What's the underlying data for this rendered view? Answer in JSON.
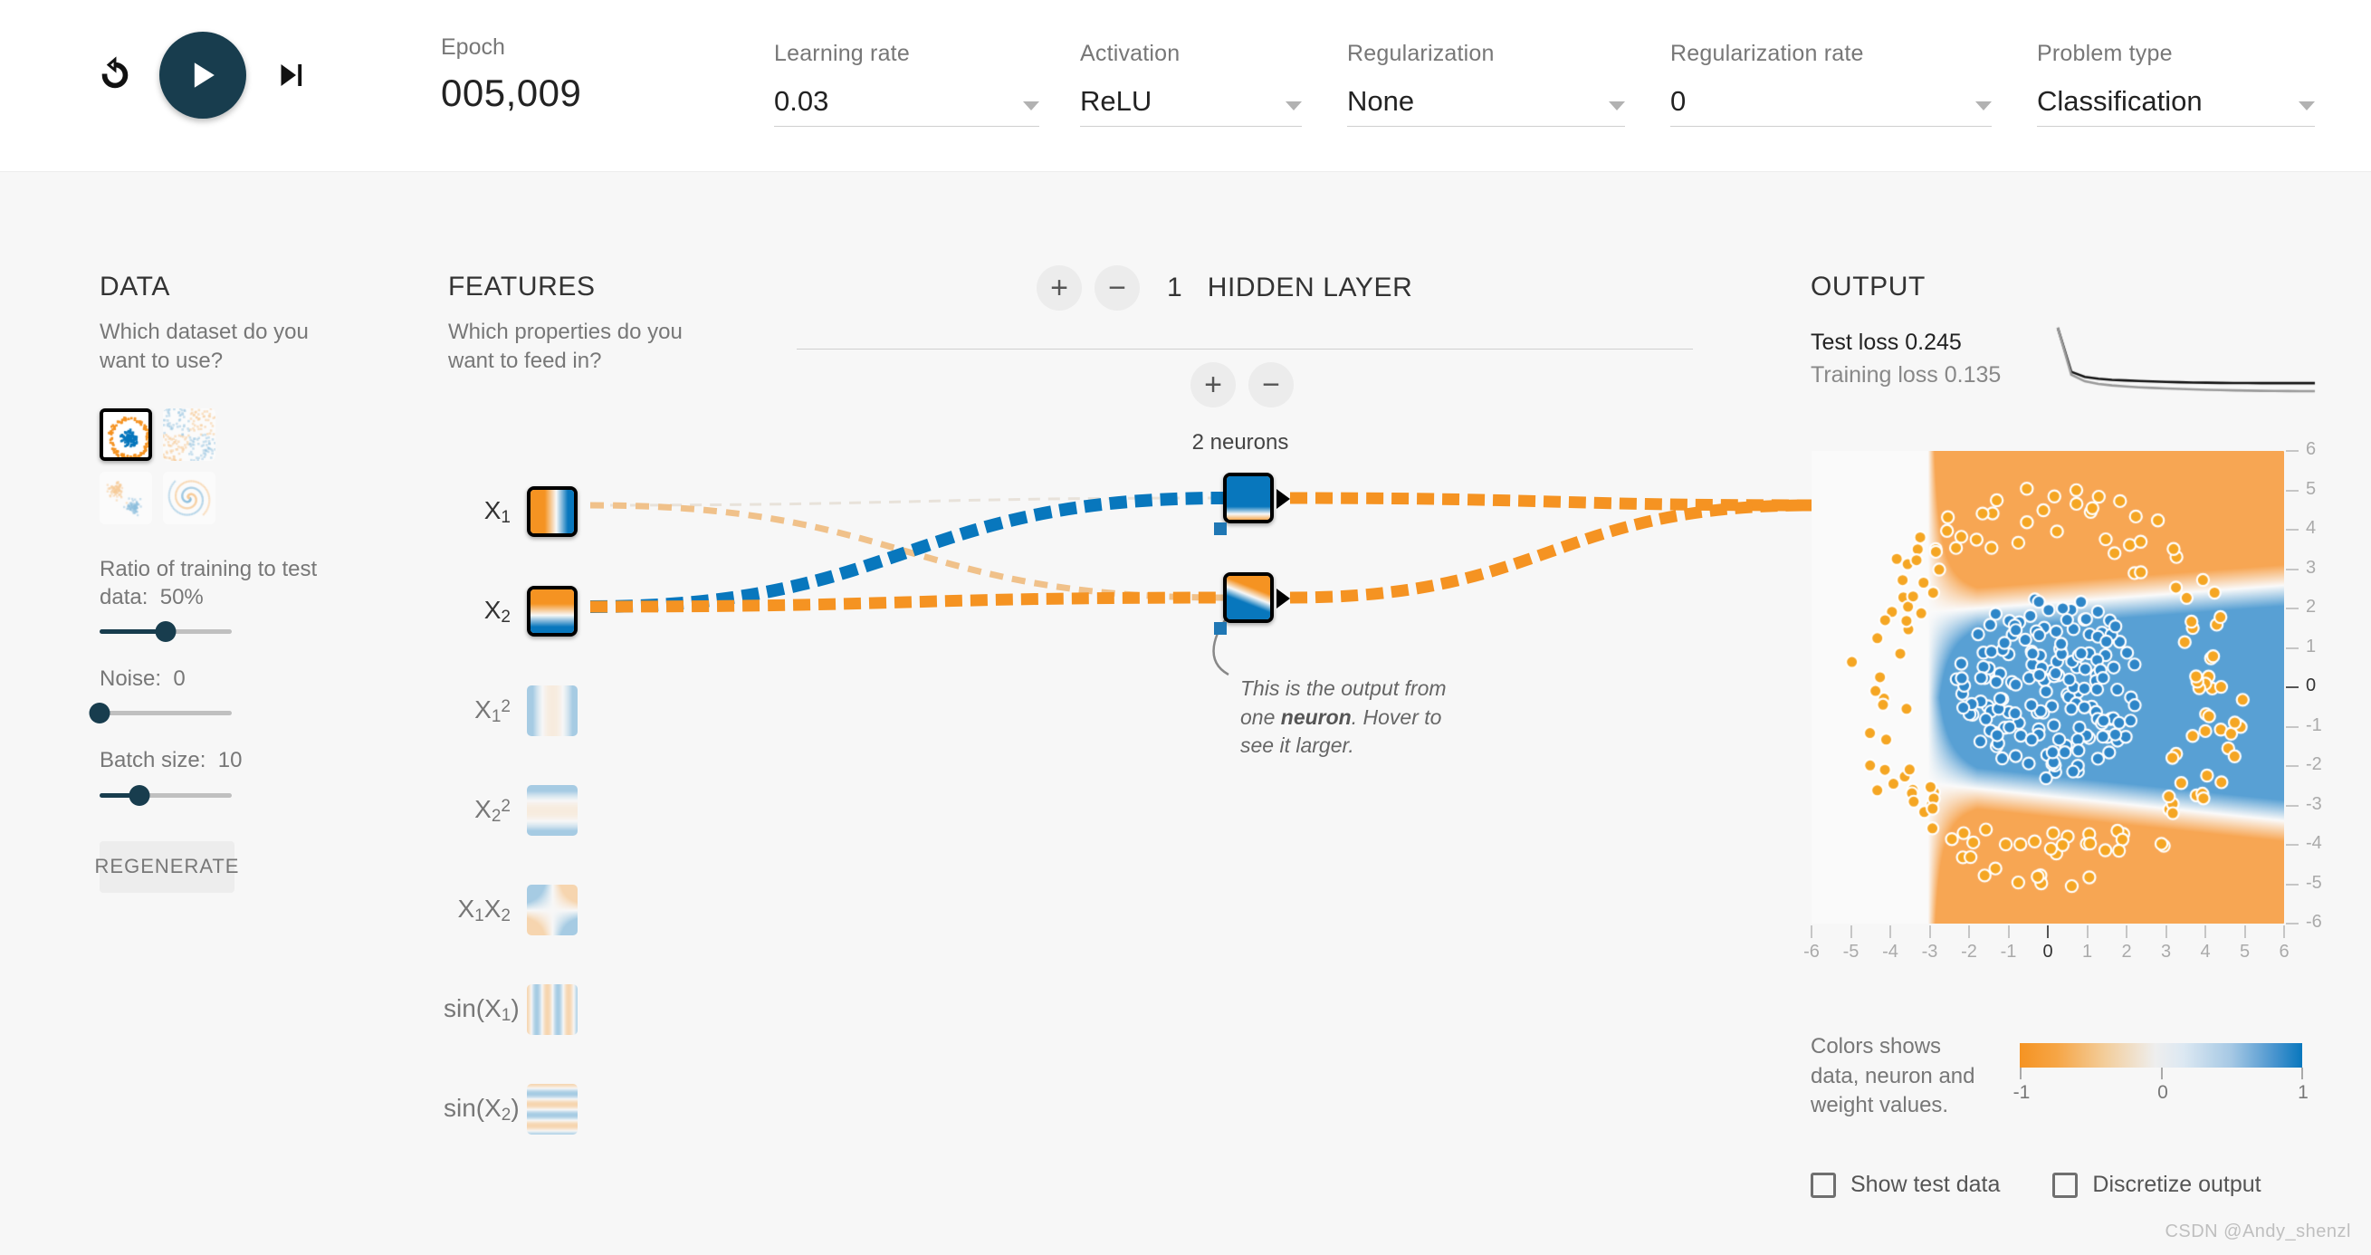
{
  "toolbar": {
    "reset_icon": "reset-icon",
    "play_icon": "play-icon",
    "step_icon": "step-forward-icon",
    "epoch_label": "Epoch",
    "epoch_value": "005,009",
    "fields": [
      {
        "label": "Learning rate",
        "value": "0.03"
      },
      {
        "label": "Activation",
        "value": "ReLU"
      },
      {
        "label": "Regularization",
        "value": "None"
      },
      {
        "label": "Regularization rate",
        "value": "0"
      },
      {
        "label": "Problem type",
        "value": "Classification"
      }
    ]
  },
  "data_panel": {
    "title": "DATA",
    "subtitle": "Which dataset do you want to use?",
    "datasets": [
      {
        "name": "circle",
        "selected": true
      },
      {
        "name": "xor",
        "selected": false
      },
      {
        "name": "gauss",
        "selected": false
      },
      {
        "name": "spiral",
        "selected": false
      }
    ],
    "ratio_label": "Ratio of training to test data:",
    "ratio_value": "50%",
    "ratio_pct": 50,
    "noise_label": "Noise:",
    "noise_value": "0",
    "noise_pct": 0,
    "batch_label": "Batch size:",
    "batch_value": "10",
    "batch_pct": 30,
    "regenerate_label": "REGENERATE"
  },
  "features_panel": {
    "title": "FEATURES",
    "subtitle": "Which properties do you want to feed in?",
    "features": [
      {
        "name": "X1",
        "label_html": "X<sub>1</sub>",
        "active": true,
        "kind": "x1"
      },
      {
        "name": "X2",
        "label_html": "X<sub>2</sub>",
        "active": true,
        "kind": "x2"
      },
      {
        "name": "X1 squared",
        "label_html": "X<sub>1</sub><sup>2</sup>",
        "active": false,
        "kind": "x1sq"
      },
      {
        "name": "X2 squared",
        "label_html": "X<sub>2</sub><sup>2</sup>",
        "active": false,
        "kind": "x2sq"
      },
      {
        "name": "X1X2",
        "label_html": "X<sub>1</sub>X<sub>2</sub>",
        "active": false,
        "kind": "x1x2"
      },
      {
        "name": "sin(X1)",
        "label_html": "sin(X<sub>1</sub>)",
        "active": false,
        "kind": "sinx1"
      },
      {
        "name": "sin(X2)",
        "label_html": "sin(X<sub>2</sub>)",
        "active": false,
        "kind": "sinx2"
      }
    ]
  },
  "network_panel": {
    "add_layer_label": "+",
    "remove_layer_label": "−",
    "layer_count": "1",
    "layer_word": "HIDDEN LAYER",
    "add_neuron_label": "+",
    "remove_neuron_label": "−",
    "neuron_count_label": "2 neurons",
    "callout_part1": "This is the output from one ",
    "callout_bold": "neuron",
    "callout_part2": ". Hover to see it larger."
  },
  "output_panel": {
    "title": "OUTPUT",
    "test_loss_label": "Test loss",
    "test_loss_value": "0.245",
    "training_loss_label": "Training loss",
    "training_loss_value": "0.135",
    "legend_text": "Colors shows data, neuron and weight values.",
    "legend_ticks": [
      "-1",
      "0",
      "1"
    ],
    "x_ticks": [
      "-6",
      "-5",
      "-4",
      "-3",
      "-2",
      "-1",
      "0",
      "1",
      "2",
      "3",
      "4",
      "5",
      "6"
    ],
    "y_ticks": [
      "6",
      "5",
      "4",
      "3",
      "2",
      "1",
      "0",
      "-1",
      "-2",
      "-3",
      "-4",
      "-5",
      "-6"
    ],
    "show_test_data_label": "Show test data",
    "discretize_output_label": "Discretize output",
    "show_test_data_checked": false,
    "discretize_output_checked": false
  },
  "colors": {
    "orange": "#f59322",
    "blue": "#0877bd",
    "dark": "#183d4e",
    "background": "#f7f7f7"
  },
  "watermark": "CSDN @Andy_shenzl",
  "chart_data": {
    "type": "line",
    "title": "Loss curve",
    "series": [
      {
        "name": "Test loss",
        "color": "#111111",
        "values": [
          1.0,
          0.4,
          0.33,
          0.305,
          0.29,
          0.282,
          0.275,
          0.268,
          0.262,
          0.258,
          0.254,
          0.251,
          0.249,
          0.247,
          0.246,
          0.245,
          0.245,
          0.245,
          0.245,
          0.245
        ]
      },
      {
        "name": "Training loss",
        "color": "#999999",
        "values": [
          1.0,
          0.36,
          0.27,
          0.235,
          0.214,
          0.2,
          0.189,
          0.18,
          0.172,
          0.166,
          0.16,
          0.155,
          0.151,
          0.147,
          0.144,
          0.141,
          0.139,
          0.137,
          0.136,
          0.135
        ]
      }
    ],
    "ylim": [
      0,
      1.0
    ],
    "grid": false,
    "legend": "none"
  }
}
